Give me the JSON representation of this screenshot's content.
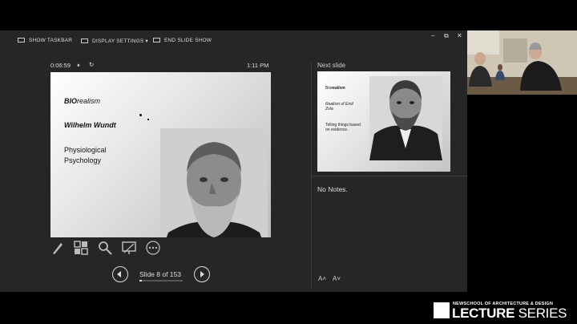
{
  "toolbar": {
    "show_taskbar": "SHOW TASKBAR",
    "display_settings": "DISPLAY SETTINGS ▾",
    "end_slide_show": "END SLIDE SHOW"
  },
  "window_controls": {
    "minimize": "–",
    "restore": "⧉",
    "close": "✕"
  },
  "status": {
    "timer": "0:06:59",
    "pause_icon": "⏸",
    "reset_icon": "↻",
    "clock": "1:11 PM"
  },
  "current_slide": {
    "line1_bold": "BIO",
    "line1_rest": "realism",
    "line2": "Wilhelm Wundt",
    "line3a": "Physiological",
    "line3b": "Psychology"
  },
  "tools": [
    "pen-icon",
    "slides-grid-icon",
    "zoom-icon",
    "screen-icon",
    "more-icon"
  ],
  "navigation": {
    "counter": "Slide 8 of 153",
    "progress": 0.052
  },
  "next_slide": {
    "label": "Next slide",
    "line1_rest": "Bio",
    "line1_bold": "realism",
    "line2a": "Realism of Emil",
    "line2b": "Zola",
    "line3a": "Telling things based",
    "line3b": "on evidence."
  },
  "notes": {
    "text": "No Notes."
  },
  "font_buttons": {
    "increase": "A˄",
    "decrease": "A˅"
  },
  "logo": {
    "small": "NEWSCHOOL OF ARCHITECTURE & DESIGN",
    "big_bold": "LECTURE",
    "big_rest": " SERIES"
  }
}
